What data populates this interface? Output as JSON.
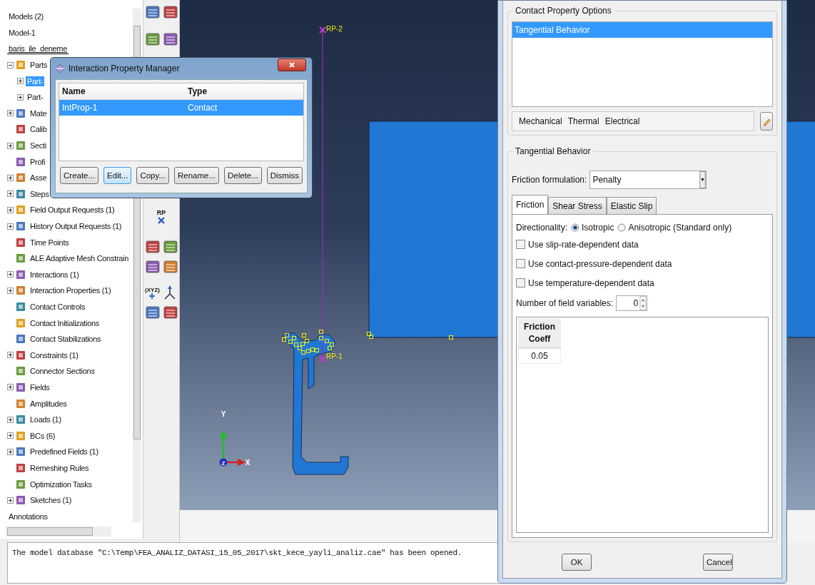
{
  "tree_panel": {
    "header": "Models (2)",
    "models": [
      {
        "label": "Model-1",
        "current": false,
        "selected": false
      },
      {
        "label": "baris_ile_deneme",
        "current": true,
        "selected": false
      }
    ],
    "items": [
      {
        "label": "Parts",
        "expanded": true,
        "selected": false,
        "children": [
          {
            "label": "Part-",
            "expanded": false,
            "selected": true
          },
          {
            "label": "Part-",
            "expanded": false,
            "selected": false
          }
        ]
      },
      {
        "label": "Mate",
        "expanded": false,
        "selected": false
      },
      {
        "label": "Calib",
        "selected": false
      },
      {
        "label": "Secti",
        "expanded": false,
        "selected": false
      },
      {
        "label": "Profi",
        "selected": false
      },
      {
        "label": "Asse",
        "expanded": false,
        "selected": false
      },
      {
        "label": "Steps",
        "expanded": false,
        "selected": false
      },
      {
        "label": "Field Output Requests (1)",
        "expanded": false,
        "selected": false
      },
      {
        "label": "History Output Requests (1)",
        "expanded": false,
        "selected": false
      },
      {
        "label": "Time Points",
        "selected": false
      },
      {
        "label": "ALE Adaptive Mesh Constrain",
        "selected": false
      },
      {
        "label": "Interactions (1)",
        "expanded": false,
        "selected": false
      },
      {
        "label": "Interaction Properties (1)",
        "expanded": false,
        "selected": false
      },
      {
        "label": "Contact Controls",
        "selected": false
      },
      {
        "label": "Contact Initializations",
        "selected": false
      },
      {
        "label": "Contact Stabilizations",
        "selected": false
      },
      {
        "label": "Constraints (1)",
        "expanded": false,
        "selected": false
      },
      {
        "label": "Connector Sections",
        "selected": false
      },
      {
        "label": "Fields",
        "expanded": false,
        "selected": false
      },
      {
        "label": "Amplitudes",
        "selected": false
      },
      {
        "label": "Loads (1)",
        "expanded": false,
        "selected": false
      },
      {
        "label": "BCs (6)",
        "expanded": false,
        "selected": false
      },
      {
        "label": "Predefined Fields (1)",
        "expanded": false,
        "selected": false
      },
      {
        "label": "Remeshing Rules",
        "selected": false
      },
      {
        "label": "Optimization Tasks",
        "selected": false
      },
      {
        "label": "Sketches (1)",
        "expanded": false,
        "selected": false
      }
    ],
    "footer": "Annotations"
  },
  "toolbar": {
    "rp_label": "RP",
    "xyz_label": "(XYZ)"
  },
  "viewport": {
    "reference_points": [
      {
        "label": "RP-2"
      },
      {
        "label": "RP-1"
      }
    ],
    "triad": {
      "x": "X",
      "y": "Y",
      "z": "Z"
    }
  },
  "manager_dialog": {
    "title": "Interaction Property Manager",
    "columns": [
      "Name",
      "Type"
    ],
    "rows": [
      {
        "name": "IntProp-1",
        "type": "Contact",
        "selected": true
      }
    ],
    "buttons": [
      {
        "label": "Create...",
        "focused": false
      },
      {
        "label": "Edit...",
        "focused": true
      },
      {
        "label": "Copy...",
        "focused": false
      },
      {
        "label": "Rename...",
        "focused": false
      },
      {
        "label": "Delete...",
        "focused": false
      },
      {
        "label": "Dismiss",
        "focused": false
      }
    ]
  },
  "edit_dialog": {
    "options_group": {
      "title": "Contact Property Options",
      "items": [
        {
          "label": "Tangential Behavior",
          "selected": true
        }
      ]
    },
    "menus": [
      "Mechanical",
      "Thermal",
      "Electrical"
    ],
    "behavior_group": {
      "title": "Tangential Behavior",
      "friction_formulation": {
        "label": "Friction formulation:",
        "value": "Penalty"
      },
      "tabs": [
        {
          "label": "Friction",
          "selected": true
        },
        {
          "label": "Shear Stress",
          "selected": false
        },
        {
          "label": "Elastic Slip",
          "selected": false
        }
      ],
      "directionality": {
        "label": "Directionality:",
        "options": [
          {
            "label": "Isotropic",
            "selected": true
          },
          {
            "label": "Anisotropic (Standard only)",
            "selected": false
          }
        ]
      },
      "checkboxes": [
        {
          "label": "Use slip-rate-dependent data",
          "checked": false
        },
        {
          "label": "Use contact-pressure-dependent data",
          "checked": false
        },
        {
          "label": "Use temperature-dependent data",
          "checked": false
        }
      ],
      "field_variables": {
        "label": "Number of field variables:",
        "value": "0"
      },
      "table": {
        "columns": [
          "Friction Coeff"
        ],
        "rows": [
          [
            "0.05"
          ]
        ]
      }
    },
    "buttons": [
      "OK",
      "Cancel"
    ]
  },
  "message_area": {
    "text": "The model database \"C:\\Temp\\FEA_ANALIZ_DATASI_15_05_2017\\skt_kece_yayli_analiz.cae\" has been opened."
  }
}
